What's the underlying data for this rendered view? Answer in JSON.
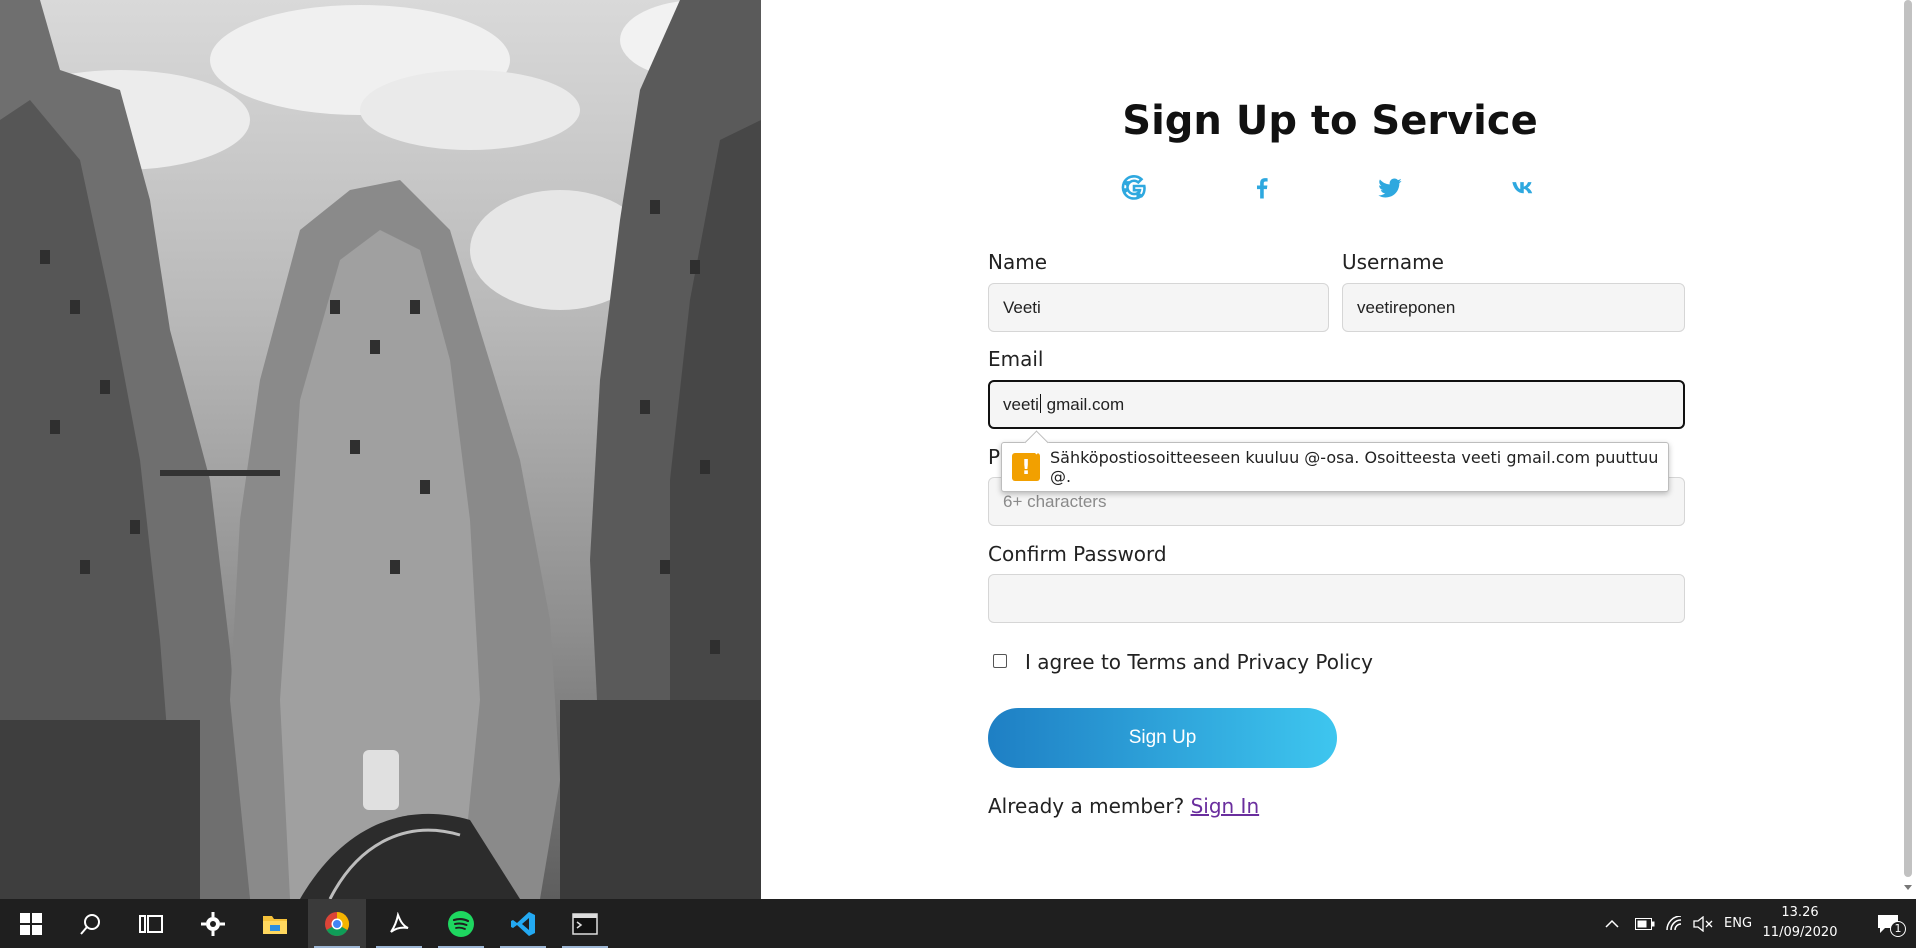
{
  "page": {
    "title": "Sign Up to Service",
    "social_icons": [
      "google-icon",
      "facebook-icon",
      "twitter-icon",
      "vk-icon"
    ],
    "accent_color": "#2ea8df"
  },
  "form": {
    "name_label": "Name",
    "name_value": "Veeti",
    "username_label": "Username",
    "username_value": "veetireponen",
    "email_label": "Email",
    "email_value_before_caret": "veeti",
    "email_value_after_caret": " gmail.com",
    "password_label": "P",
    "password_placeholder": "6+ characters",
    "confirm_label": "Confirm Password",
    "confirm_value": "",
    "agree_text": "I agree to Terms and Privacy Policy",
    "agree_checked": false,
    "signup_label": "Sign Up",
    "member_text": "Already a member?",
    "signin_link": "Sign In"
  },
  "validation_tooltip": {
    "icon": "warning-icon",
    "icon_glyph": "!",
    "message": "Sähköpostiosoitteeseen kuuluu @-osa. Osoitteesta veeti gmail.com puuttuu @.",
    "color": "#f2a000"
  },
  "taskbar": {
    "apps": [
      "windows-start-icon",
      "search-icon",
      "task-view-icon",
      "settings-icon",
      "file-explorer-icon",
      "chrome-icon",
      "acrobat-icon",
      "spotify-icon",
      "vscode-icon",
      "terminal-icon"
    ],
    "language": "ENG",
    "time": "13.26",
    "date": "11/09/2020",
    "notification_count": "1"
  }
}
